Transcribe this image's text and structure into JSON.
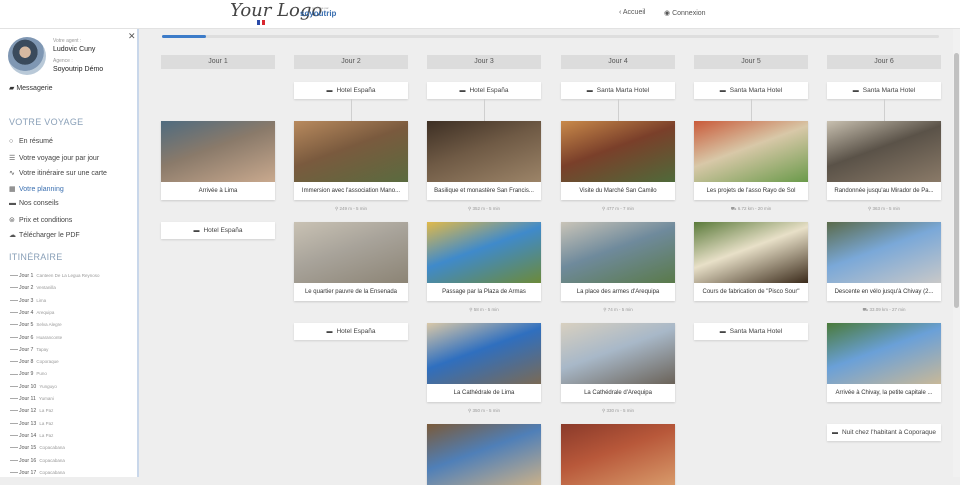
{
  "header": {
    "logo_text": "Your Logo",
    "brand_small": "propulsé par",
    "brand_name": "soyoutrip",
    "nav": [
      {
        "label": "Accueil",
        "icon": "chevron-left-icon"
      },
      {
        "label": "Connexion",
        "icon": "user-circle-icon"
      }
    ]
  },
  "sidebar": {
    "agent_label": "Votre agent :",
    "agent_name": "Ludovic Cuny",
    "agency_label": "Agence :",
    "agency_name": "Soyoutrip Démo",
    "messagerie": "Messagerie",
    "voyage_heading": "VOTRE VOYAGE",
    "menu": [
      {
        "label": "En résumé",
        "icon": "circle-icon"
      },
      {
        "label": "Votre voyage jour par jour",
        "icon": "list-icon"
      },
      {
        "label": "Votre itinéraire sur une carte",
        "icon": "route-icon"
      },
      {
        "label": "Votre planning",
        "icon": "grid-icon"
      },
      {
        "label": "Nos conseils",
        "icon": "book-icon"
      },
      {
        "label": "Prix et conditions",
        "icon": "euro-icon"
      },
      {
        "label": "Télécharger le PDF",
        "icon": "cloud-download-icon"
      }
    ],
    "itineraire_heading": "ITINÉRAIRE",
    "jours": [
      {
        "label": "Jour 1",
        "place": "Canteen De La Legua Reynoso"
      },
      {
        "label": "Jour 2",
        "place": "Ventanilla"
      },
      {
        "label": "Jour 3",
        "place": "Lima"
      },
      {
        "label": "Jour 4",
        "place": "Arequipa"
      },
      {
        "label": "Jour 5",
        "place": "Selva Alegre"
      },
      {
        "label": "Jour 6",
        "place": "Huaranconte"
      },
      {
        "label": "Jour 7",
        "place": "Tapay"
      },
      {
        "label": "Jour 8",
        "place": "Coporaque"
      },
      {
        "label": "Jour 9",
        "place": "Puno"
      },
      {
        "label": "Jour 10",
        "place": "Yunguyo"
      },
      {
        "label": "Jour 11",
        "place": "Yumani"
      },
      {
        "label": "Jour 12",
        "place": "La Paz"
      },
      {
        "label": "Jour 13",
        "place": "La Paz"
      },
      {
        "label": "Jour 14",
        "place": "La Paz"
      },
      {
        "label": "Jour 15",
        "place": "Copacabana"
      },
      {
        "label": "Jour 16",
        "place": "Copacabana"
      },
      {
        "label": "Jour 17",
        "place": "Copacabana"
      }
    ]
  },
  "progress_fraction": 0.057,
  "days": [
    {
      "title": "Jour 1",
      "hotel_top": "",
      "cards": [
        {
          "caption": "Arrivée à Lima",
          "transit": "",
          "image": "aerial-city-coast",
          "colors": [
            "#8a7a6a",
            "#4f6b7f",
            "#c9a98e"
          ]
        }
      ],
      "hotel_after": "Hotel España"
    },
    {
      "title": "Jour 2",
      "hotel_top": "Hotel España",
      "cards": [
        {
          "caption": "Immersion avec l'association Mano...",
          "transit": "249 m - 5 min",
          "image": "mosaic-wall",
          "colors": [
            "#7a5a3e",
            "#b88a5e",
            "#5a6b3f"
          ]
        },
        {
          "caption": "Le quartier pauvre de la Ensenada",
          "transit": "",
          "image": "desert-hillside-town",
          "colors": [
            "#a8a39a",
            "#c9c2b4",
            "#8c8475"
          ]
        }
      ],
      "hotel_after": "Hotel España"
    },
    {
      "title": "Jour 3",
      "hotel_top": "Hotel España",
      "cards": [
        {
          "caption": "Basilique et monastère San Francis...",
          "transit": "352 m - 5 min",
          "image": "carved-stone-facade",
          "colors": [
            "#6f5a45",
            "#3d2f24",
            "#9c8468"
          ]
        },
        {
          "caption": "Passage par la Plaza de Armas",
          "transit": "58 m - 5 min",
          "image": "plaza-palm-trees",
          "colors": [
            "#3f8acb",
            "#e0b94a",
            "#6c8a3a"
          ]
        },
        {
          "caption": "La Cathédrale de Lima",
          "transit": "350 m - 5 min",
          "image": "cathedral-blue-sky",
          "colors": [
            "#2f6fbf",
            "#d9c8a8",
            "#7a6a55"
          ]
        },
        {
          "caption": "",
          "transit": "",
          "image": "colonial-courtyard",
          "colors": [
            "#4f7fb8",
            "#7a5a3a",
            "#c9b08a"
          ]
        }
      ],
      "hotel_after": ""
    },
    {
      "title": "Jour 4",
      "hotel_top": "Santa Marta Hotel",
      "cards": [
        {
          "caption": "Visite du Marché San Camilo",
          "transit": "477 m - 7 min",
          "image": "market-produce",
          "colors": [
            "#7a3f2a",
            "#c98a4a",
            "#4f6a3a"
          ]
        },
        {
          "caption": "La place des armes d'Arequipa",
          "transit": "74 m - 5 min",
          "image": "city-square-aerial",
          "colors": [
            "#6f8a9c",
            "#c9c4b8",
            "#5a7a4a"
          ]
        },
        {
          "caption": "La Cathédrale d'Arequipa",
          "transit": "330 m - 5 min",
          "image": "white-stone-towers",
          "colors": [
            "#a8b8c8",
            "#d8d0c0",
            "#6a6258"
          ]
        },
        {
          "caption": "",
          "transit": "",
          "image": "red-colonial-street",
          "colors": [
            "#b8583a",
            "#8a3a2a",
            "#d89a6a"
          ]
        }
      ],
      "hotel_after": ""
    },
    {
      "title": "Jour 5",
      "hotel_top": "Santa Marta Hotel",
      "cards": [
        {
          "caption": "Les projets de l'asso Rayo de Sol",
          "transit": "6.72 km - 20 min",
          "image": "children-playroom",
          "colors": [
            "#d8c8a8",
            "#c95a3a",
            "#6a9a4a"
          ]
        },
        {
          "caption": "Cours de fabrication de \"Pisco Sour\"",
          "transit": "",
          "image": "cocktail-glass",
          "colors": [
            "#e8e0c8",
            "#5a7a3a",
            "#3a2a1a"
          ]
        }
      ],
      "hotel_after": "Santa Marta Hotel"
    },
    {
      "title": "Jour 6",
      "hotel_top": "Santa Marta Hotel",
      "cards": [
        {
          "caption": "Randonnée jusqu'au Mirador de Pa...",
          "transit": "363 m - 5 min",
          "image": "llama-portrait",
          "colors": [
            "#5a5248",
            "#c8c0b0",
            "#8a7a68"
          ]
        },
        {
          "caption": "Descente en vélo jusqu'à Chivay (2...",
          "transit": "33.09 km - 27 min",
          "image": "cyclists-road",
          "colors": [
            "#7aa8d8",
            "#5a6a4a",
            "#c8c8c8"
          ]
        },
        {
          "caption": "Arrivée à Chivay, la petite capitale ...",
          "transit": "",
          "image": "village-arch-trees",
          "colors": [
            "#6aa0d8",
            "#4a7a3a",
            "#c8b898"
          ]
        }
      ],
      "hotel_after": "Nuit chez l'habitant à Coporaque"
    }
  ]
}
